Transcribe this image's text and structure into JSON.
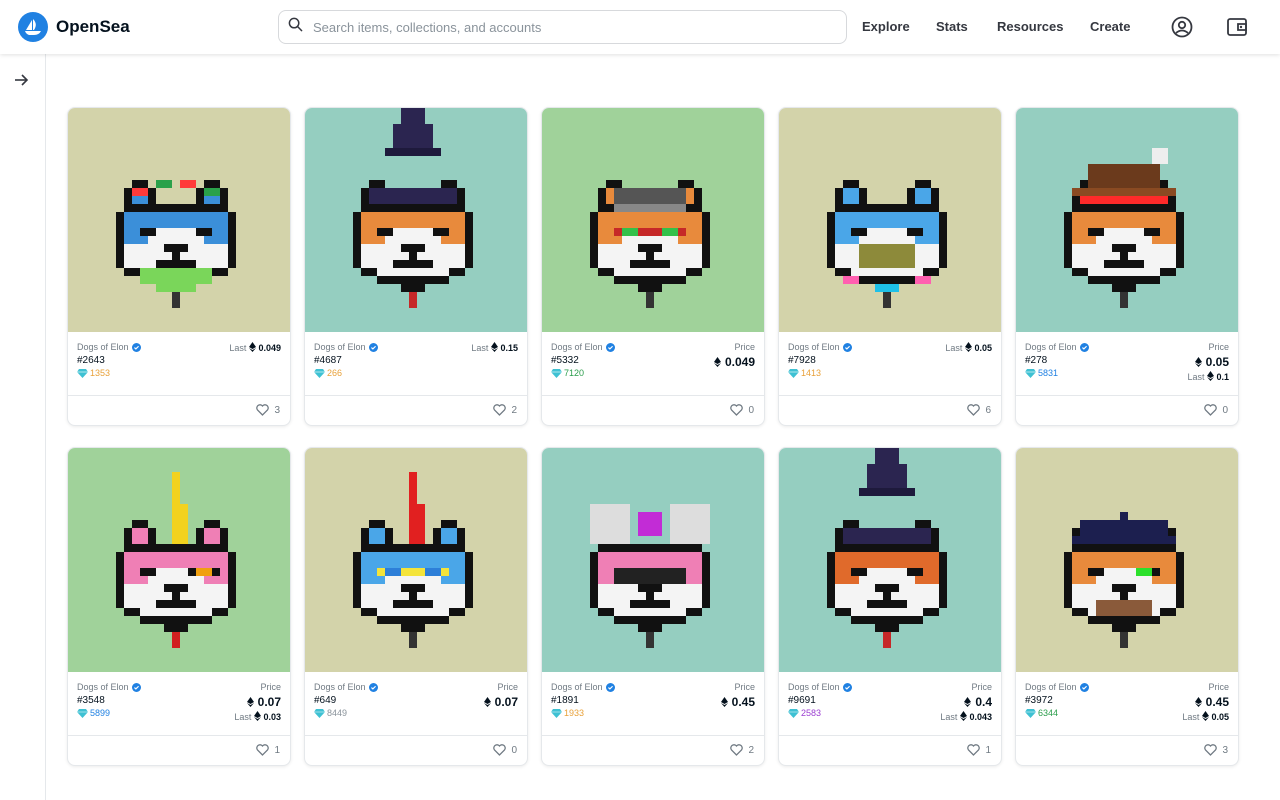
{
  "header": {
    "logo_text": "OpenSea",
    "search_placeholder": "Search items, collections, and accounts",
    "nav": [
      "Explore",
      "Stats",
      "Resources",
      "Create"
    ]
  },
  "colors": {
    "brand": "#2081e2",
    "bg_beige": "#d3d3aa",
    "bg_teal": "#95cec0",
    "bg_green": "#a0d29a"
  },
  "cards": [
    {
      "collection": "Dogs of Elon",
      "token": "#2643",
      "rank": "1353",
      "rank_color": "#e8a13a",
      "mode": "last",
      "last": "0.049",
      "likes": "3",
      "bg": "#d3d3aa",
      "hat": "flower",
      "fur": "#3b8fd9"
    },
    {
      "collection": "Dogs of Elon",
      "token": "#4687",
      "rank": "266",
      "rank_color": "#e8a13a",
      "mode": "last",
      "last": "0.15",
      "likes": "2",
      "bg": "#95cec0",
      "hat": "wizard",
      "fur": "#e88a3c"
    },
    {
      "collection": "Dogs of Elon",
      "token": "#5332",
      "rank": "7120",
      "rank_color": "#2a9d4b",
      "mode": "price",
      "price": "0.049",
      "likes": "0",
      "bg": "#a0d29a",
      "hat": "cap",
      "fur": "#e88a3c"
    },
    {
      "collection": "Dogs of Elon",
      "token": "#7928",
      "rank": "1413",
      "rank_color": "#e8a13a",
      "mode": "last",
      "last": "0.05",
      "likes": "6",
      "bg": "#d3d3aa",
      "hat": "none",
      "fur": "#4aa6e8"
    },
    {
      "collection": "Dogs of Elon",
      "token": "#278",
      "rank": "5831",
      "rank_color": "#2081e2",
      "mode": "price_last",
      "price": "0.05",
      "last": "0.1",
      "likes": "0",
      "bg": "#95cec0",
      "hat": "cowboy",
      "fur": "#e88a3c"
    },
    {
      "collection": "Dogs of Elon",
      "token": "#3548",
      "rank": "5899",
      "rank_color": "#2081e2",
      "mode": "price_last",
      "price": "0.07",
      "last": "0.03",
      "likes": "1",
      "bg": "#a0d29a",
      "hat": "mohawk",
      "fur": "#ef7fb5"
    },
    {
      "collection": "Dogs of Elon",
      "token": "#649",
      "rank": "8449",
      "rank_color": "#8a939b",
      "mode": "price",
      "price": "0.07",
      "likes": "0",
      "bg": "#d3d3aa",
      "hat": "mohawk-red",
      "fur": "#4aa6e8"
    },
    {
      "collection": "Dogs of Elon",
      "token": "#1891",
      "rank": "1933",
      "rank_color": "#e8a13a",
      "mode": "price",
      "price": "0.45",
      "likes": "2",
      "bg": "#95cec0",
      "hat": "mouse",
      "fur": "#ef7fb5"
    },
    {
      "collection": "Dogs of Elon",
      "token": "#9691",
      "rank": "2583",
      "rank_color": "#9b3ed1",
      "mode": "price_last",
      "price": "0.4",
      "last": "0.043",
      "likes": "1",
      "bg": "#95cec0",
      "hat": "wizard",
      "fur": "#e06a2b"
    },
    {
      "collection": "Dogs of Elon",
      "token": "#3972",
      "rank": "6344",
      "rank_color": "#2a9d4b",
      "mode": "price_last",
      "price": "0.45",
      "last": "0.05",
      "likes": "3",
      "bg": "#d3d3aa",
      "hat": "beret",
      "fur": "#e88a3c"
    }
  ],
  "labels": {
    "last": "Last",
    "price": "Price"
  }
}
